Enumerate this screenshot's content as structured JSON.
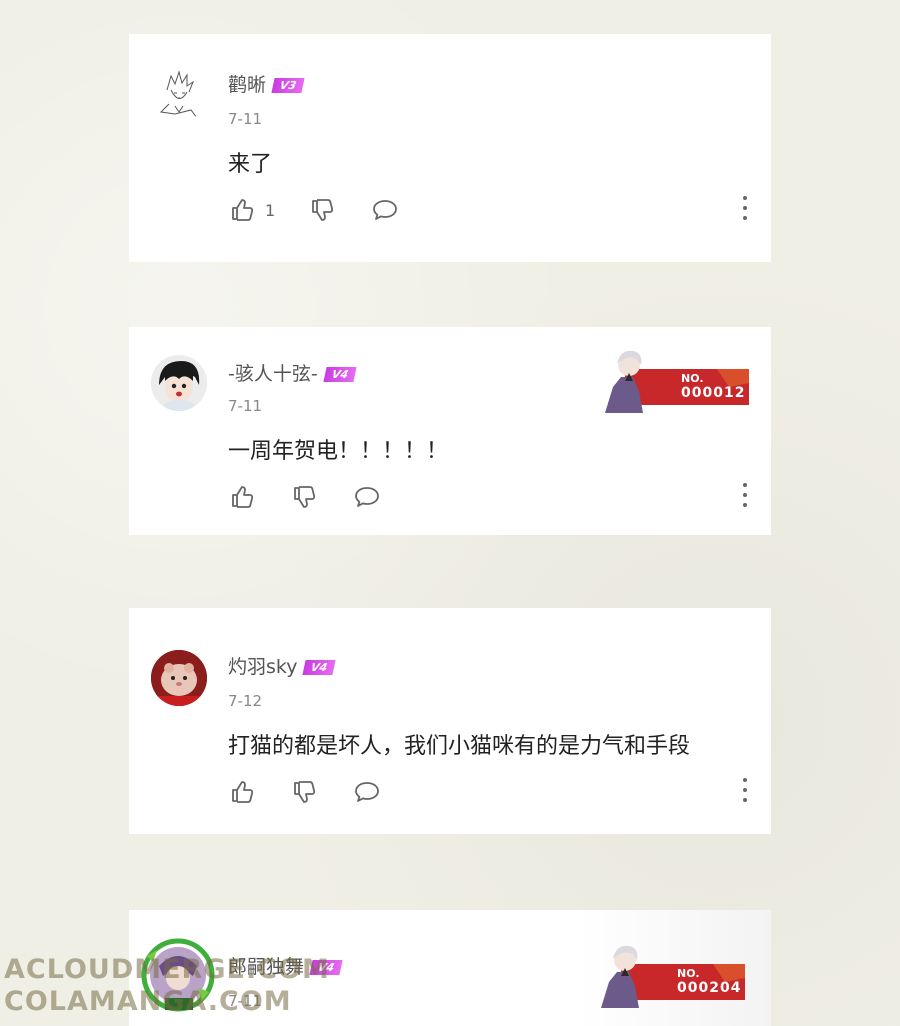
{
  "comments": [
    {
      "username": "鹳晰",
      "level": "V3",
      "date": "7-11",
      "text": "来了",
      "likes": "1",
      "avatar_icon": "sketch-character-avatar"
    },
    {
      "username": "-骇人十弦-",
      "level": "V4",
      "date": "7-11",
      "text": "一周年贺电！！！！！",
      "likes": "",
      "badge_number": "000012",
      "badge_prefix": "NO.",
      "avatar_icon": "anime-character-avatar"
    },
    {
      "username": "灼羽sky",
      "level": "V4",
      "date": "7-12",
      "text": "打猫的都是坏人，我们小猫咪有的是力气和手段",
      "likes": "",
      "avatar_icon": "hamster-avatar"
    },
    {
      "username": "郎嗣独舞",
      "level": "V4",
      "date": "7-11",
      "badge_number": "000204",
      "badge_prefix": "NO.",
      "avatar_icon": "character-avatar-with-frame"
    }
  ],
  "watermark": {
    "line1": "ACLOUDMERGE.COM",
    "line2": "COLAMANGA.COM"
  },
  "colors": {
    "background": "#f0efe6",
    "card": "#ffffff",
    "level_badge": "#d44fe8",
    "number_badge": "#c8282a"
  }
}
